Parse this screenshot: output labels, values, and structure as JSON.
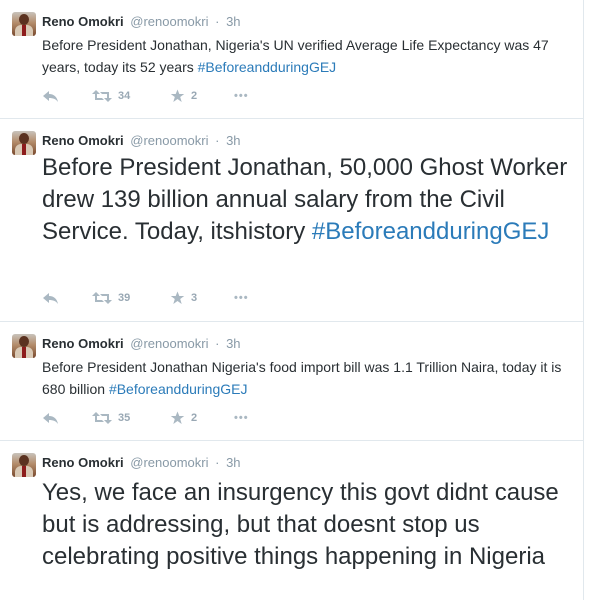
{
  "tweets": [
    {
      "fullname": "Reno Omokri",
      "handle": "@renoomokri",
      "separator": "·",
      "time": "3h",
      "text": "Before President Jonathan, Nigeria's UN verified Average Life Expectancy was 47 years, today its 52 years ",
      "hashtag": "#BeforeandduringGEJ",
      "retweets": "34",
      "favorites": "2",
      "more": "•••"
    },
    {
      "fullname": "Reno Omokri",
      "handle": "@renoomokri",
      "separator": "·",
      "time": "3h",
      "text": "Before President Jonathan, 50,000 Ghost Worker drew 139 billion annual salary from the Civil Service. Today, itshistory ",
      "hashtag": "#BeforeandduringGEJ",
      "retweets": "39",
      "favorites": "3",
      "more": "•••"
    },
    {
      "fullname": "Reno Omokri",
      "handle": "@renoomokri",
      "separator": "·",
      "time": "3h",
      "text": "Before President Jonathan Nigeria's food import bill was 1.1 Trillion Naira, today it is 680 billion ",
      "hashtag": "#BeforeandduringGEJ",
      "retweets": "35",
      "favorites": "2",
      "more": "•••"
    },
    {
      "fullname": "Reno Omokri",
      "handle": "@renoomokri",
      "separator": "·",
      "time": "3h",
      "text": "Yes, we face an insurgency this govt didnt cause but is addressing, but that doesnt stop us celebrating positive things happening in Nigeria"
    }
  ],
  "icons": {
    "reply": "reply-icon",
    "retweet": "retweet-icon",
    "favorite": "star-icon",
    "more": "more-options-icon"
  },
  "colors": {
    "text": "#292f33",
    "muted": "#8899a6",
    "hashtag": "#2b7bb9",
    "action": "#aab8c2",
    "divider": "#e1e8ed"
  }
}
